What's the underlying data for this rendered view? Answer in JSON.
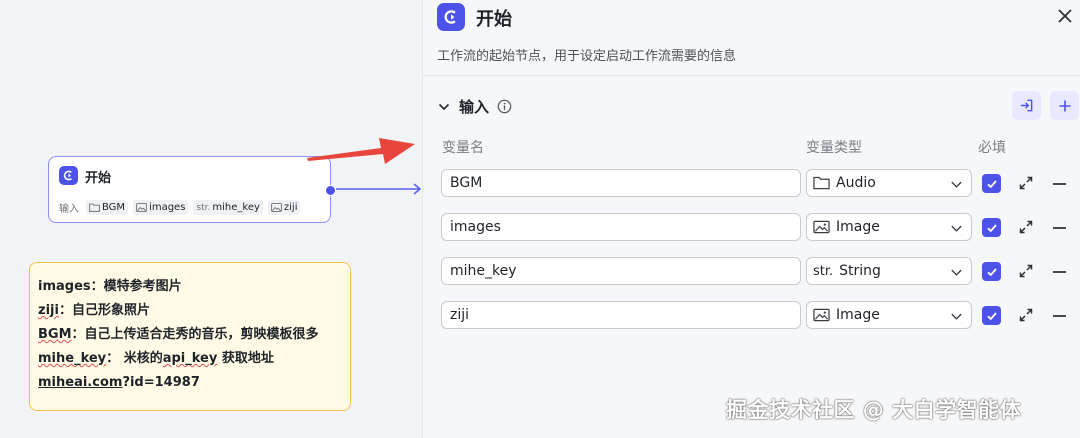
{
  "colors": {
    "accent": "#4d53e8",
    "note_bg": "#fffbe6",
    "note_border": "#f5c34a",
    "arrow": "#e8453c"
  },
  "node": {
    "title": "开始",
    "io_label": "输入",
    "chips": [
      {
        "type_icon": "folder-icon",
        "type_text": "",
        "name": "BGM"
      },
      {
        "type_icon": "image-icon",
        "type_text": "",
        "name": "images"
      },
      {
        "type_icon": "",
        "type_text": "str.",
        "name": "mihe_key"
      },
      {
        "type_icon": "image-icon",
        "type_text": "",
        "name": "ziji"
      }
    ]
  },
  "note": {
    "lines": [
      {
        "a": "images",
        "b": "：模特参考图片"
      },
      {
        "a": "ziji",
        "b": "：自己形象照片"
      },
      {
        "a": "BGM",
        "b": "：自己上传适合走秀的音乐，剪映模板很多"
      },
      {
        "a": "mihe_key",
        "b": "：  米核的",
        "c": "api_key",
        "d": " 获取地址"
      },
      {
        "a": "miheai.com",
        "b": "?id=14987"
      }
    ]
  },
  "panel": {
    "title": "开始",
    "description": "工作流的起始节点，用于设定启动工作流需要的信息",
    "section_title": "输入",
    "columns": {
      "name": "变量名",
      "type": "变量类型",
      "required": "必填"
    },
    "rows": [
      {
        "name": "BGM",
        "type": "Audio",
        "type_icon": "folder-icon",
        "type_prefix": "",
        "required": true
      },
      {
        "name": "images",
        "type": "Image",
        "type_icon": "image-icon",
        "type_prefix": "",
        "required": true
      },
      {
        "name": "mihe_key",
        "type": "String",
        "type_icon": "",
        "type_prefix": "str.",
        "required": true
      },
      {
        "name": "ziji",
        "type": "Image",
        "type_icon": "image-icon",
        "type_prefix": "",
        "required": true
      }
    ]
  },
  "watermark": "掘金技术社区 @ 大白学智能体"
}
